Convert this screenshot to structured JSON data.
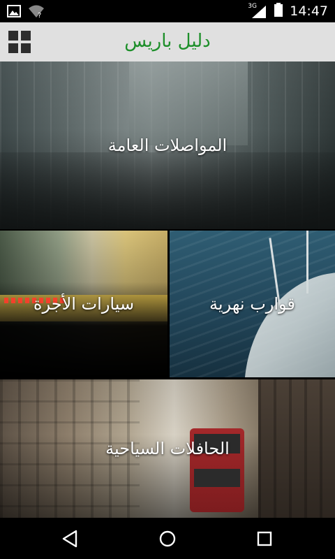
{
  "status_bar": {
    "time": "14:47",
    "network_type": "3G",
    "icons": [
      "image-icon",
      "wifi-icon",
      "signal-icon",
      "battery-icon"
    ]
  },
  "app_bar": {
    "title": "دليل باريس",
    "menu_icon": "grid-icon",
    "title_color": "#1d8f2a"
  },
  "tiles": [
    {
      "label": "المواصلات العامة"
    },
    {
      "label": "سيارات الأجرة"
    },
    {
      "label": "قوارب نهرية"
    },
    {
      "label": "الحافلات السياحية"
    }
  ],
  "nav_bar": {
    "buttons": [
      "back-icon",
      "home-icon",
      "recent-apps-icon"
    ]
  }
}
